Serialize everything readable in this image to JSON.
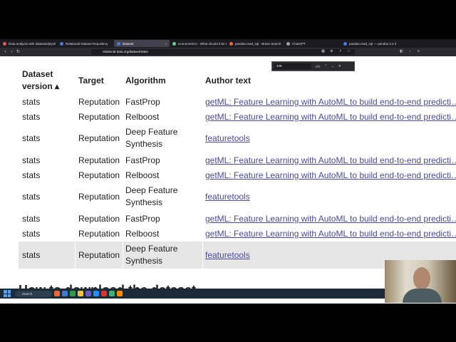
{
  "browser": {
    "tabs": [
      {
        "label": "Data analysis with datasets/plyml",
        "color": "#e05a5a",
        "active": false
      },
      {
        "label": "Relational Dataset Repository",
        "color": "#4a7ad9",
        "active": false
      },
      {
        "label": "Dataset",
        "color": "#4a7ad9",
        "active": true
      },
      {
        "label": "econometrics - What should it be tak",
        "color": "#6cd38b",
        "active": false
      },
      {
        "label": "pandas.read_sql - Brave Search",
        "color": "#e8683a",
        "active": false
      },
      {
        "label": "ChatGPT",
        "color": "#9aa0a6",
        "active": false
      },
      {
        "label": "pandas.read_sql — pandas 2.2.3 do",
        "color": "#4a7ad9",
        "active": false
      }
    ],
    "url": "relational-data.org/dataset/Stats",
    "find": {
      "query": "429",
      "count": "0/0"
    }
  },
  "table": {
    "headers": {
      "dataset_version": "Dataset version",
      "sort_arrow": "▴",
      "target": "Target",
      "algorithm": "Algorithm",
      "author_text": "Author text"
    },
    "rows": [
      {
        "version": "stats",
        "target": "Reputation",
        "algorithm": "FastProp",
        "author": "getML: Feature Learning with AutoML to build end-to-end predicti…"
      },
      {
        "version": "stats",
        "target": "Reputation",
        "algorithm": "Relboost",
        "author": "getML: Feature Learning with AutoML to build end-to-end predicti…"
      },
      {
        "version": "stats",
        "target": "Reputation",
        "algorithm": "Deep Feature Synthesis",
        "author": "featuretools"
      },
      {
        "version": "stats",
        "target": "Reputation",
        "algorithm": "FastProp",
        "author": "getML: Feature Learning with AutoML to build end-to-end predicti…"
      },
      {
        "version": "stats",
        "target": "Reputation",
        "algorithm": "Relboost",
        "author": "getML: Feature Learning with AutoML to build end-to-end predicti…"
      },
      {
        "version": "stats",
        "target": "Reputation",
        "algorithm": "Deep Feature Synthesis",
        "author": "featuretools"
      },
      {
        "version": "stats",
        "target": "Reputation",
        "algorithm": "FastProp",
        "author": "getML: Feature Learning with AutoML to build end-to-end predicti…"
      },
      {
        "version": "stats",
        "target": "Reputation",
        "algorithm": "Relboost",
        "author": "getML: Feature Learning with AutoML to build end-to-end predicti…"
      },
      {
        "version": "stats",
        "target": "Reputation",
        "algorithm": "Deep Feature Synthesis",
        "author": "featuretools"
      }
    ]
  },
  "section_heading": "How to download the dataset",
  "taskbar": {
    "search_label": "Search"
  }
}
